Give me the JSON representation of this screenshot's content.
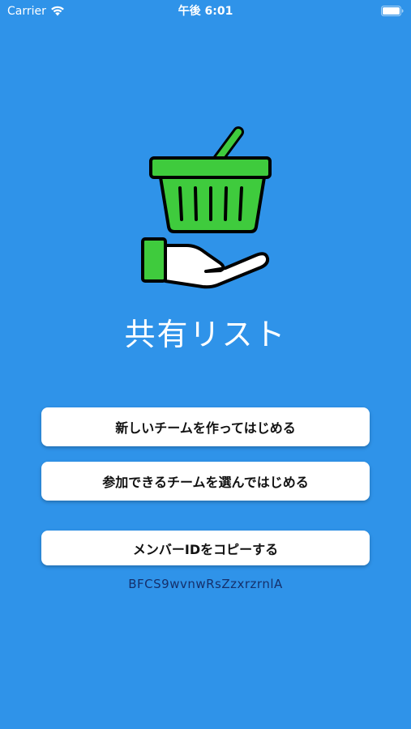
{
  "status_bar": {
    "carrier": "Carrier",
    "time": "午後 6:01"
  },
  "app": {
    "title": "共有リスト",
    "logo_icon": "basket-hand-icon",
    "colors": {
      "background": "#2f93e9",
      "basket": "#3fcb3d",
      "button_bg": "#ffffff",
      "member_id_text": "#15306b"
    }
  },
  "buttons": {
    "create_team": "新しいチームを作ってはじめる",
    "join_team": "参加できるチームを選んではじめる",
    "copy_member_id": "メンバーIDをコピーする"
  },
  "member_id": "BFCS9wvnwRsZzxrzrnlA"
}
